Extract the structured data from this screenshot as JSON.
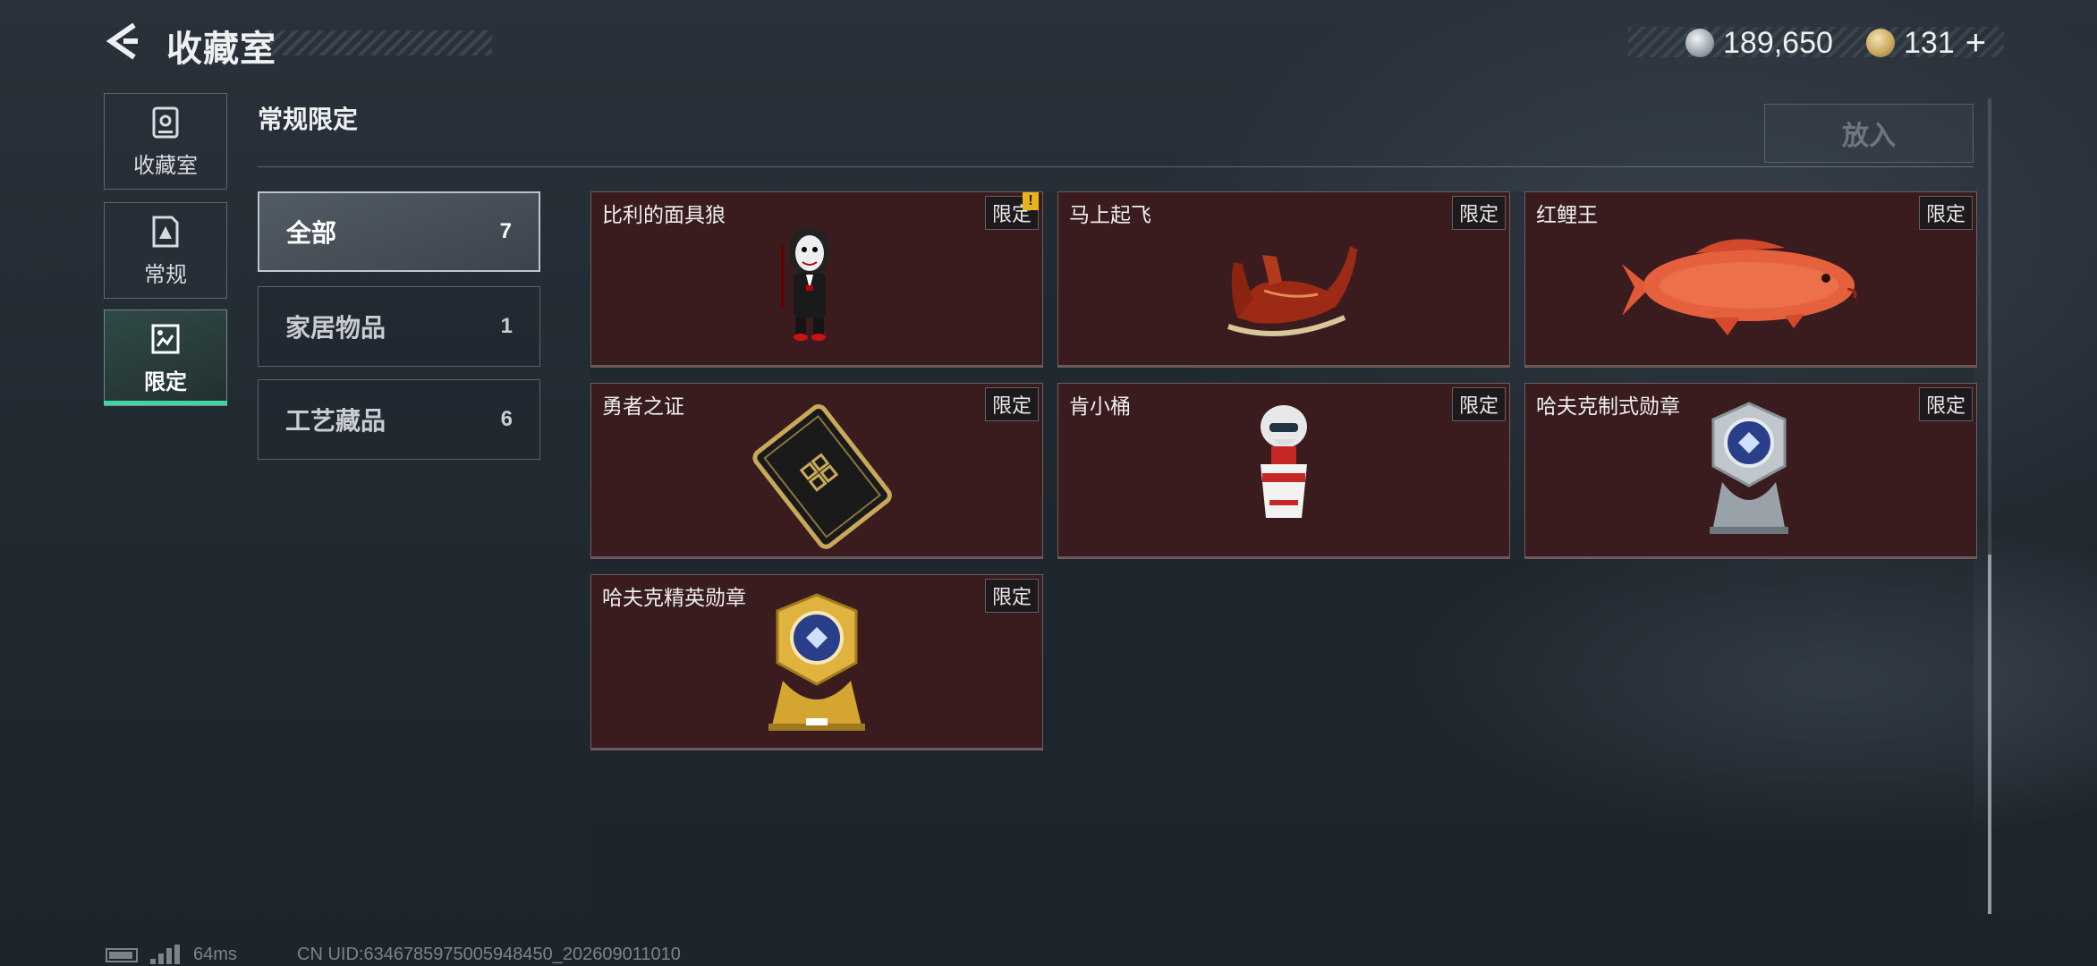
{
  "header": {
    "title": "收藏室",
    "currency_silver": "189,650",
    "currency_gold": "131",
    "currency_plus": "+"
  },
  "nav": [
    {
      "label": "收藏室",
      "icon": "collection-room-icon",
      "active": false
    },
    {
      "label": "常规",
      "icon": "regular-icon",
      "active": false
    },
    {
      "label": "限定",
      "icon": "limited-icon",
      "active": true
    }
  ],
  "section": {
    "title": "常规限定",
    "put_button": "放入"
  },
  "filters": [
    {
      "label": "全部",
      "count": "7",
      "active": true
    },
    {
      "label": "家居物品",
      "count": "1",
      "active": false
    },
    {
      "label": "工艺藏品",
      "count": "6",
      "active": false
    }
  ],
  "items": [
    {
      "name": "比利的面具狼",
      "badge": "限定",
      "alert": "!",
      "icon": "billy-puppet-icon"
    },
    {
      "name": "马上起飞",
      "badge": "限定",
      "icon": "flying-horse-icon"
    },
    {
      "name": "红鲤王",
      "badge": "限定",
      "icon": "red-carp-icon"
    },
    {
      "name": "勇者之证",
      "badge": "限定",
      "icon": "brave-card-icon"
    },
    {
      "name": "肯小桶",
      "badge": "限定",
      "icon": "kfc-bucket-figure-icon"
    },
    {
      "name": "哈夫克制式勋章",
      "badge": "限定",
      "icon": "silver-medal-icon"
    },
    {
      "name": "哈夫克精英勋章",
      "badge": "限定",
      "icon": "gold-medal-icon"
    }
  ],
  "footer": {
    "ping": "64ms",
    "uid": "CN UID:6346785975005948450_202609011010"
  },
  "colors": {
    "accent": "#3fd6a6",
    "card_bg": "#3a1c1f",
    "badge_alert": "#e8b41c"
  }
}
